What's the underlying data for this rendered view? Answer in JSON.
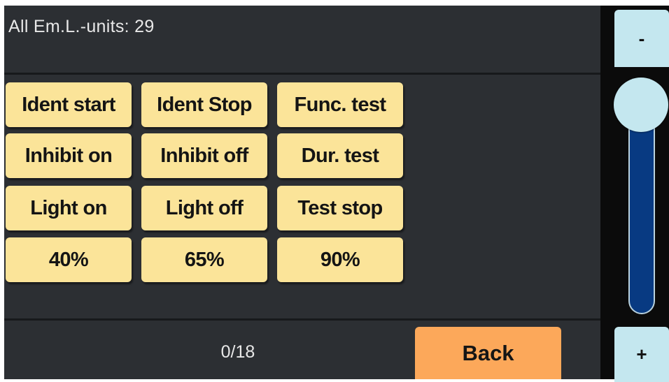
{
  "header": {
    "title": "All Em.L.-units: 29"
  },
  "buttons": [
    {
      "name": "ident-start-button",
      "label": "Ident start"
    },
    {
      "name": "ident-stop-button",
      "label": "Ident Stop"
    },
    {
      "name": "func-test-button",
      "label": "Func. test"
    },
    {
      "name": "inhibit-on-button",
      "label": "Inhibit on"
    },
    {
      "name": "inhibit-off-button",
      "label": "Inhibit off"
    },
    {
      "name": "dur-test-button",
      "label": "Dur. test"
    },
    {
      "name": "light-on-button",
      "label": "Light on"
    },
    {
      "name": "light-off-button",
      "label": "Light off"
    },
    {
      "name": "test-stop-button",
      "label": "Test stop"
    },
    {
      "name": "level-40-button",
      "label": "40%"
    },
    {
      "name": "level-65-button",
      "label": "65%"
    },
    {
      "name": "level-90-button",
      "label": "90%"
    }
  ],
  "footer": {
    "counter": "0/18",
    "back_label": "Back"
  },
  "scroll": {
    "minus_label": "-",
    "plus_label": "+",
    "position": 0
  },
  "colors": {
    "background": "#2c2f33",
    "button": "#fbe499",
    "back_button": "#fca85a",
    "scroll_button": "#c4e7ef",
    "slider_track": "#083a82"
  }
}
